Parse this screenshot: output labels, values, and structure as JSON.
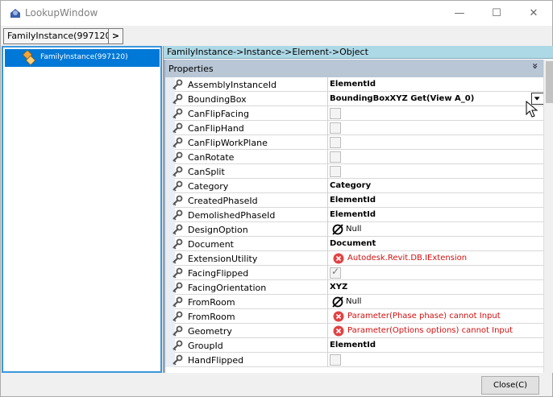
{
  "window": {
    "title": "LookupWindow",
    "controls": {
      "minimize": "—",
      "maximize": "☐",
      "close": "✕"
    }
  },
  "breadcrumb": {
    "items": [
      {
        "label": "FamilyInstance(997120)"
      },
      {
        "label": ">"
      }
    ]
  },
  "tree": {
    "items": [
      {
        "label": "FamilyInstance(997120)",
        "icon": "family-instance-icon",
        "selected": true
      }
    ]
  },
  "path": "FamilyInstance->Instance->Element->Object",
  "grid": {
    "category": "Properties",
    "collapse_glyph": "»",
    "rows": [
      {
        "name": "AssemblyInstanceId",
        "kind": "bold",
        "value": "ElementId"
      },
      {
        "name": "BoundingBox",
        "kind": "bold-dropdown",
        "value": "BoundingBoxXYZ Get(View A_0)"
      },
      {
        "name": "CanFlipFacing",
        "kind": "check",
        "checked": false
      },
      {
        "name": "CanFlipHand",
        "kind": "check",
        "checked": false
      },
      {
        "name": "CanFlipWorkPlane",
        "kind": "check",
        "checked": false
      },
      {
        "name": "CanRotate",
        "kind": "check",
        "checked": false
      },
      {
        "name": "CanSplit",
        "kind": "check",
        "checked": false
      },
      {
        "name": "Category",
        "kind": "bold",
        "value": "Category"
      },
      {
        "name": "CreatedPhaseId",
        "kind": "bold",
        "value": "ElementId"
      },
      {
        "name": "DemolishedPhaseId",
        "kind": "bold",
        "value": "ElementId"
      },
      {
        "name": "DesignOption",
        "kind": "null",
        "value": "Null"
      },
      {
        "name": "Document",
        "kind": "bold",
        "value": "Document"
      },
      {
        "name": "ExtensionUtility",
        "kind": "error",
        "value": "Autodesk.Revit.DB.IExtension"
      },
      {
        "name": "FacingFlipped",
        "kind": "check",
        "checked": true
      },
      {
        "name": "FacingOrientation",
        "kind": "bold",
        "value": "XYZ"
      },
      {
        "name": "FromRoom",
        "kind": "null",
        "value": "Null"
      },
      {
        "name": "FromRoom",
        "kind": "error",
        "value": "Parameter(Phase phase) cannot Input"
      },
      {
        "name": "Geometry",
        "kind": "error",
        "value": "Parameter(Options options) cannot Input"
      },
      {
        "name": "GroupId",
        "kind": "bold",
        "value": "ElementId"
      },
      {
        "name": "HandFlipped",
        "kind": "check",
        "checked": false
      }
    ]
  },
  "footer": {
    "close_label": "Close(C)"
  },
  "colors": {
    "selection": "#0078d7",
    "path_bar": "#add8e6",
    "category_bar": "#b8c6d6",
    "error": "#d01010"
  }
}
